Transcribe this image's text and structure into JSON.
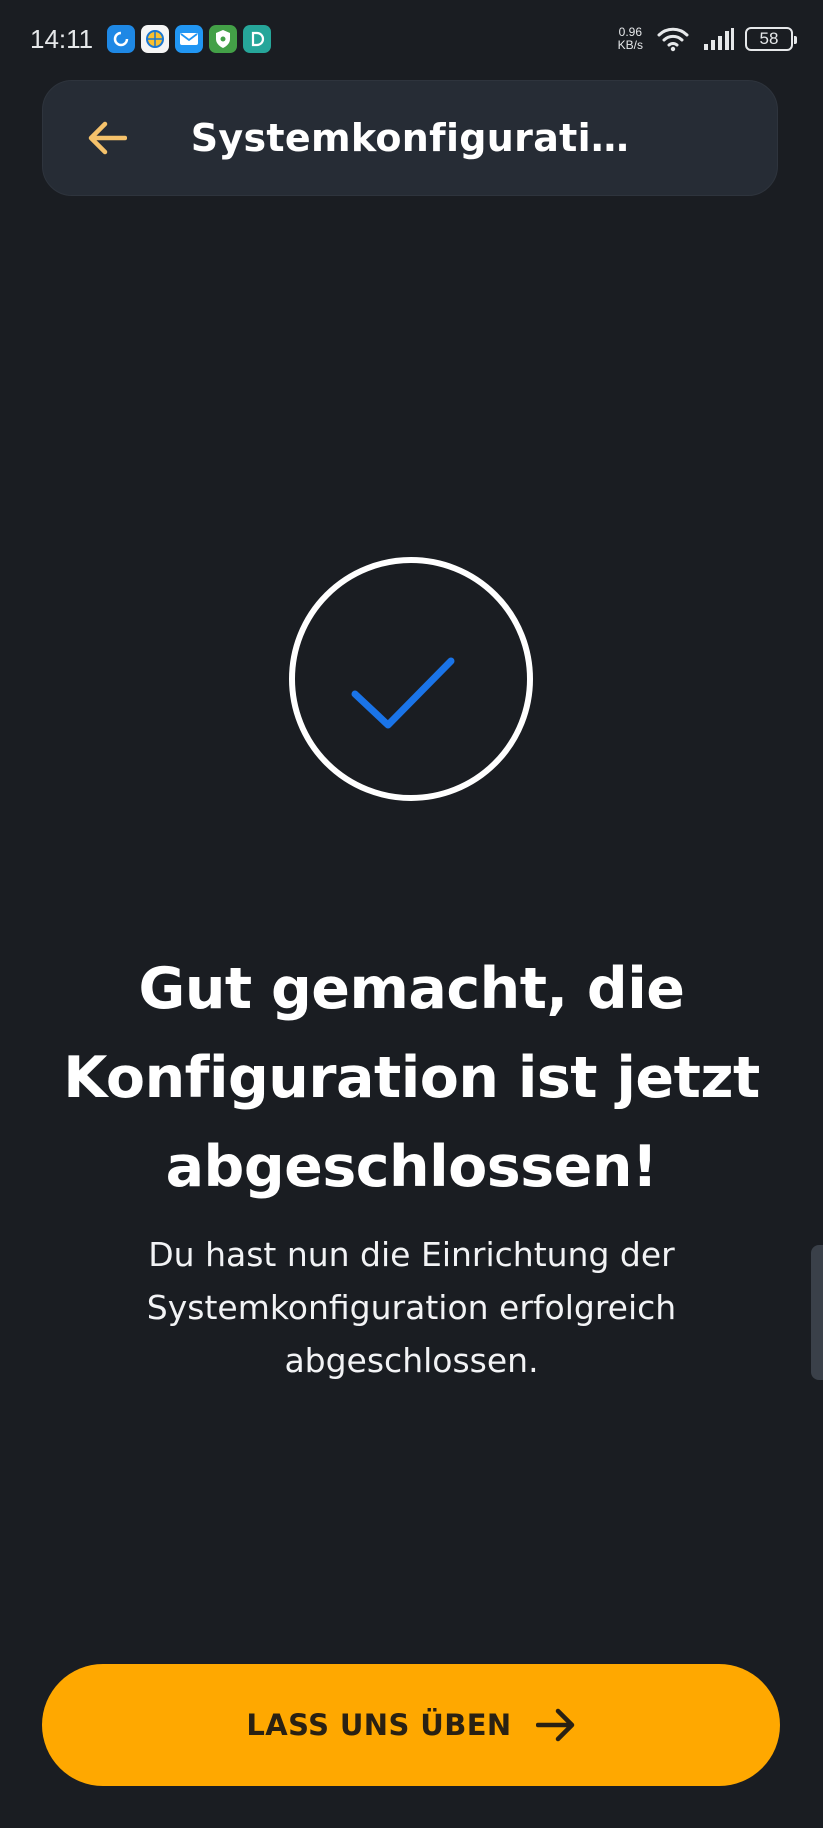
{
  "status_bar": {
    "time": "14:11",
    "net_speed_value": "0.96",
    "net_speed_unit": "KB/s",
    "battery": "58",
    "notification_icons": [
      {
        "name": "refresh-app-icon",
        "color": "#1e88e5",
        "glyph": "C"
      },
      {
        "name": "globe-app-icon",
        "color": "#f5f5f5",
        "glyph": "#"
      },
      {
        "name": "mail-app-icon",
        "color": "#2196f3",
        "glyph": "✉"
      },
      {
        "name": "shield-app-icon",
        "color": "#43a047",
        "glyph": "⛨"
      },
      {
        "name": "teal-app-icon",
        "color": "#26a69a",
        "glyph": "D"
      }
    ]
  },
  "header": {
    "title": "Systemkonfigurati…",
    "back_icon": "arrow-left-icon",
    "back_icon_color": "#f5c26b"
  },
  "success": {
    "icon": "check-circle-icon",
    "check_color": "#1a74e8"
  },
  "headline": "Gut gemacht, die Konfiguration ist jetzt abgeschlossen!",
  "description": "Du hast nun die Einrichtung der Systemkonfiguration erfolgreich abgeschlossen.",
  "cta": {
    "label": "LASS UNS ÜBEN",
    "icon": "arrow-right-icon",
    "color": "#ffa800"
  }
}
